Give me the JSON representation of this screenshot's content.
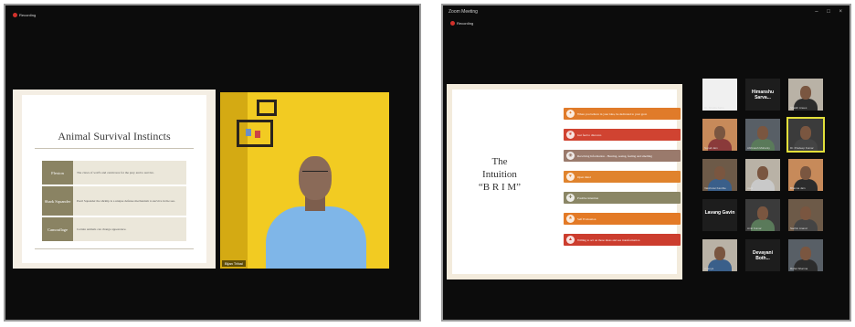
{
  "left": {
    "recording_label": "Recording",
    "slide": {
      "title": "Animal Survival Instincts",
      "rows": [
        {
          "label": "Flexion",
          "text": "The claws of wolf's and carnivores for the prey and to survive."
        },
        {
          "label": "Shark Squander",
          "text": "Pearl Squander the shrimp is a unique defense mechanism to survive in the sea."
        },
        {
          "label": "Camouflage",
          "text": "Certain animals can change appearance."
        }
      ]
    },
    "video": {
      "participant_name": "Bijan Tribal"
    }
  },
  "right": {
    "window_title": "Zoom Meeting",
    "recording_label": "Recording",
    "window_controls": "–  □  ×",
    "slide": {
      "title_lines": [
        "The",
        "Intuition",
        "“B R I M”"
      ],
      "bars": [
        {
          "icon": "lightbulb-icon",
          "glyph": "✦",
          "color": "#e07b2a",
          "text": "When you believe in your idea, be dedicated to your goal."
        },
        {
          "icon": "brain-icon",
          "glyph": "❦",
          "color": "#d04331",
          "text": "Gut feel to discover."
        },
        {
          "icon": "eye-icon",
          "glyph": "◉",
          "color": "#9a7a6c",
          "text": "Receiving Information - Hearing, seeing, feeling and smelling"
        },
        {
          "icon": "heart-icon",
          "glyph": "♥",
          "color": "#e0832d",
          "text": "Open mind"
        },
        {
          "icon": "compass-icon",
          "glyph": "✚",
          "color": "#8a8665",
          "text": "Positive intention"
        },
        {
          "icon": "star-icon",
          "glyph": "★",
          "color": "#e37a26",
          "text": "Self Evaluation"
        },
        {
          "icon": "alert-icon",
          "glyph": "▲",
          "color": "#cc3d2e",
          "text": "Willing to act on those ideas and see transformation"
        }
      ]
    },
    "gallery": [
      {
        "label": "Dr. Shukla Sahu",
        "kind": "blank"
      },
      {
        "label": "Himanshu Sarva...",
        "kind": "name"
      },
      {
        "label": "Shaikh Anees",
        "kind": "video"
      },
      {
        "label": "Sonali Jain",
        "kind": "video"
      },
      {
        "label": "Abhinash Mohanty",
        "kind": "video"
      },
      {
        "label": "Dr. Pradeep Kumar",
        "kind": "video"
      },
      {
        "label": "Vaishnavi Kamble",
        "kind": "video"
      },
      {
        "label": "Aarti",
        "kind": "video"
      },
      {
        "label": "Bhavna Jain",
        "kind": "video"
      },
      {
        "label": "Lavang Gavin",
        "kind": "name"
      },
      {
        "label": "Amit Kumar",
        "kind": "video"
      },
      {
        "label": "Sachin Anand",
        "kind": "video"
      },
      {
        "label": "Ananya",
        "kind": "video"
      },
      {
        "label": "Devayani Both...",
        "kind": "name"
      },
      {
        "label": "Rahul Sharma",
        "kind": "video"
      }
    ],
    "accent_colors": {
      "active_speaker": "#e3e03a"
    }
  }
}
